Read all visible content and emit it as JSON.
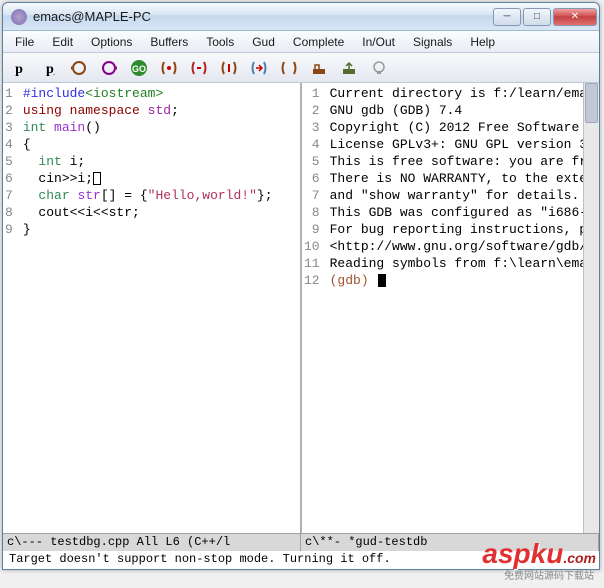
{
  "window": {
    "title": "emacs@MAPLE-PC"
  },
  "menu": [
    "File",
    "Edit",
    "Options",
    "Buffers",
    "Tools",
    "Gud",
    "Complete",
    "In/Out",
    "Signals",
    "Help"
  ],
  "toolbar_icons": [
    "p-bold",
    "p-sub",
    "loop1",
    "loop2",
    "go-green",
    "skip1",
    "skip2",
    "skip3",
    "skip4",
    "skip5",
    "misc1",
    "misc2",
    "bulb"
  ],
  "left_pane": {
    "lines": [
      {
        "n": 1,
        "segs": [
          [
            "#include",
            "kw-pp"
          ],
          [
            "<iostream>",
            "kw-inc"
          ]
        ]
      },
      {
        "n": 2,
        "segs": [
          [
            "using",
            "kw-using"
          ],
          [
            " ",
            ""
          ],
          [
            "namespace",
            "kw-using"
          ],
          [
            " ",
            ""
          ],
          [
            "std",
            "kw-ns"
          ],
          [
            ";",
            ""
          ]
        ]
      },
      {
        "n": 3,
        "segs": [
          [
            "int",
            "kw-type"
          ],
          [
            " ",
            ""
          ],
          [
            "main",
            "txt-purple"
          ],
          [
            "()",
            ""
          ]
        ]
      },
      {
        "n": 4,
        "segs": [
          [
            "{",
            ""
          ]
        ]
      },
      {
        "n": 5,
        "segs": [
          [
            "  ",
            ""
          ],
          [
            "int",
            "kw-type"
          ],
          [
            " i;",
            ""
          ]
        ]
      },
      {
        "n": 6,
        "segs": [
          [
            "  cin>>i;",
            ""
          ]
        ],
        "cursor_box": true
      },
      {
        "n": 7,
        "segs": [
          [
            "  ",
            ""
          ],
          [
            "char",
            "kw-type"
          ],
          [
            " ",
            ""
          ],
          [
            "str",
            "txt-purple"
          ],
          [
            "[] = {",
            ""
          ],
          [
            "\"Hello,world!\"",
            "kw-str"
          ],
          [
            "};",
            ""
          ]
        ]
      },
      {
        "n": 8,
        "segs": [
          [
            "  cout<<i<<str;",
            ""
          ]
        ]
      },
      {
        "n": 9,
        "segs": [
          [
            "}",
            ""
          ]
        ]
      }
    ]
  },
  "right_pane": {
    "lines": [
      {
        "n": 1,
        "text": "Current directory is f:/learn/ema"
      },
      {
        "n": 2,
        "text": "GNU gdb (GDB) 7.4"
      },
      {
        "n": 3,
        "text": "Copyright (C) 2012 Free Software "
      },
      {
        "n": 4,
        "text": "License GPLv3+: GNU GPL version 3"
      },
      {
        "n": 5,
        "text": "This is free software: you are fr"
      },
      {
        "n": 6,
        "text": "There is NO WARRANTY, to the exte"
      },
      {
        "n": 7,
        "text": "and \"show warranty\" for details."
      },
      {
        "n": 8,
        "text": "This GDB was configured as \"i686-"
      },
      {
        "n": 9,
        "text": "For bug reporting instructions, p"
      },
      {
        "n": 10,
        "text": "<http://www.gnu.org/software/gdb/"
      },
      {
        "n": 11,
        "text": "Reading symbols from f:\\learn\\ema"
      },
      {
        "n": 12,
        "prompt": "(gdb) ",
        "block_cursor": true
      }
    ]
  },
  "modeline": {
    "left": "c\\---  testdbg.cpp    All L6      (C++/l",
    "right": "c\\**-  *gud-testdb"
  },
  "minibuffer": "Target doesn't support non-stop mode.  Turning it off.",
  "watermark": {
    "main": "aspku",
    "ext": ".com",
    "sub": "免费网站源码下载站"
  }
}
